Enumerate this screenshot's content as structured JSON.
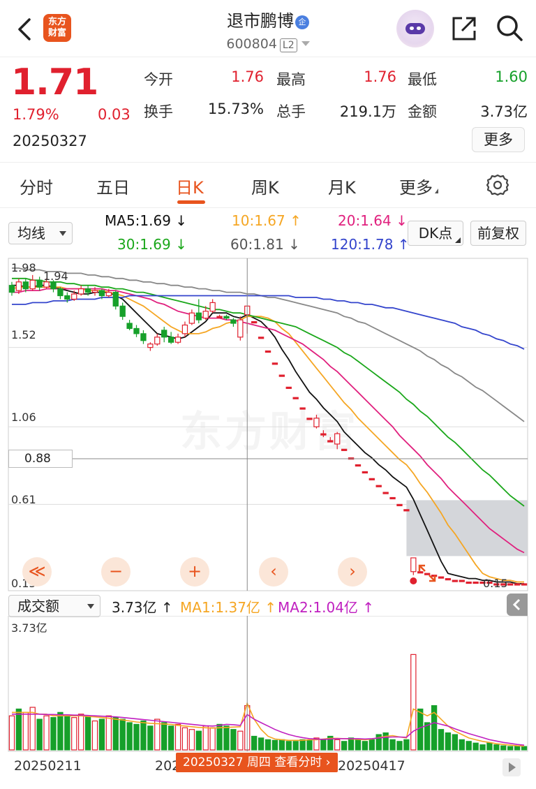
{
  "header": {
    "title": "退市鹏博",
    "badge": "企",
    "code": "600804",
    "level": "L2",
    "logo_text": "东方财富"
  },
  "quote": {
    "price": "1.71",
    "pct": "1.79%",
    "change": "0.03",
    "date": "20250327",
    "open_label": "今开",
    "open": "1.76",
    "high_label": "最高",
    "high": "1.76",
    "low_label": "最低",
    "low": "1.60",
    "turnover_label": "换手",
    "turnover": "15.73%",
    "volume_label": "总手",
    "volume": "219.1万",
    "amount_label": "金额",
    "amount": "3.73亿",
    "more": "更多"
  },
  "tabs": [
    "分时",
    "五日",
    "日K",
    "周K",
    "月K",
    "更多"
  ],
  "active_tab": "日K",
  "ma_bar": {
    "indicator": "均线",
    "ma5": "MA5:1.69",
    "ma5_arrow": "↓",
    "ma10": "10:1.67",
    "ma10_arrow": "↑",
    "ma20": "20:1.64",
    "ma20_arrow": "↓",
    "ma30": "30:1.69",
    "ma30_arrow": "↓",
    "ma60": "60:1.81",
    "ma60_arrow": "↓",
    "ma120": "120:1.78",
    "ma120_arrow": "↑",
    "dk_button": "DK点",
    "adjust_button": "前复权"
  },
  "colors": {
    "up": "#e0202e",
    "down": "#16a02a",
    "ma5": "#111111",
    "ma10": "#f5a623",
    "ma20": "#e0207e",
    "ma30": "#1aa71a",
    "ma60": "#888888",
    "ma120": "#3344cc",
    "accent": "#e8541e"
  },
  "axis": {
    "y_labels": [
      "1.98",
      "1.52",
      "1.06",
      "0.61",
      "0.15"
    ],
    "crosshair_price": "0.88",
    "high_annotation": "1.94",
    "low_annotation": "0.15"
  },
  "controls": [
    "≪",
    "−",
    "+",
    "‹",
    "›"
  ],
  "volume": {
    "indicator": "成交额",
    "value": "3.73亿",
    "value_arrow": "↑",
    "ma1": "MA1:1.37亿",
    "ma1_arrow": "↑",
    "ma2": "MA2:1.04亿",
    "ma2_arrow": "↑",
    "axis_max": "3.73亿"
  },
  "dates": {
    "d1": "20250211",
    "d2": "20250",
    "d3": "20250417",
    "tip": "20250327 周四 查看分时"
  },
  "watermark": "东方财富",
  "chart_data": {
    "type": "candlestick",
    "ylim": [
      0.15,
      1.98
    ],
    "candles": [
      {
        "o": 1.88,
        "c": 1.84,
        "h": 1.9,
        "l": 1.82
      },
      {
        "o": 1.85,
        "c": 1.9,
        "h": 1.92,
        "l": 1.83
      },
      {
        "o": 1.9,
        "c": 1.86,
        "h": 1.92,
        "l": 1.84
      },
      {
        "o": 1.86,
        "c": 1.91,
        "h": 1.94,
        "l": 1.85
      },
      {
        "o": 1.91,
        "c": 1.87,
        "h": 1.93,
        "l": 1.85
      },
      {
        "o": 1.87,
        "c": 1.9,
        "h": 1.92,
        "l": 1.86
      },
      {
        "o": 1.9,
        "c": 1.86,
        "h": 1.91,
        "l": 1.84
      },
      {
        "o": 1.86,
        "c": 1.82,
        "h": 1.87,
        "l": 1.8
      },
      {
        "o": 1.82,
        "c": 1.8,
        "h": 1.84,
        "l": 1.78
      },
      {
        "o": 1.8,
        "c": 1.83,
        "h": 1.85,
        "l": 1.79
      },
      {
        "o": 1.83,
        "c": 1.86,
        "h": 1.88,
        "l": 1.82
      },
      {
        "o": 1.86,
        "c": 1.84,
        "h": 1.88,
        "l": 1.82
      },
      {
        "o": 1.84,
        "c": 1.85,
        "h": 1.87,
        "l": 1.82
      },
      {
        "o": 1.85,
        "c": 1.82,
        "h": 1.86,
        "l": 1.8
      },
      {
        "o": 1.82,
        "c": 1.84,
        "h": 1.86,
        "l": 1.81
      },
      {
        "o": 1.84,
        "c": 1.76,
        "h": 1.85,
        "l": 1.74
      },
      {
        "o": 1.76,
        "c": 1.7,
        "h": 1.78,
        "l": 1.68
      },
      {
        "o": 1.66,
        "c": 1.63,
        "h": 1.68,
        "l": 1.62
      },
      {
        "o": 1.63,
        "c": 1.6,
        "h": 1.65,
        "l": 1.58
      },
      {
        "o": 1.6,
        "c": 1.56,
        "h": 1.62,
        "l": 1.54
      },
      {
        "o": 1.52,
        "c": 1.54,
        "h": 1.55,
        "l": 1.5
      },
      {
        "o": 1.54,
        "c": 1.58,
        "h": 1.6,
        "l": 1.53
      },
      {
        "o": 1.62,
        "c": 1.58,
        "h": 1.64,
        "l": 1.55
      },
      {
        "o": 1.58,
        "c": 1.55,
        "h": 1.61,
        "l": 1.54
      },
      {
        "o": 1.55,
        "c": 1.58,
        "h": 1.6,
        "l": 1.54
      },
      {
        "o": 1.6,
        "c": 1.65,
        "h": 1.67,
        "l": 1.58
      },
      {
        "o": 1.66,
        "c": 1.72,
        "h": 1.74,
        "l": 1.65
      },
      {
        "o": 1.72,
        "c": 1.68,
        "h": 1.8,
        "l": 1.66
      },
      {
        "o": 1.69,
        "c": 1.73,
        "h": 1.76,
        "l": 1.68
      },
      {
        "o": 1.73,
        "c": 1.78,
        "h": 1.8,
        "l": 1.72
      },
      {
        "o": 1.7,
        "c": 1.7,
        "h": 1.71,
        "l": 1.69
      },
      {
        "o": 1.7,
        "c": 1.69,
        "h": 1.71,
        "l": 1.68
      },
      {
        "o": 1.68,
        "c": 1.66,
        "h": 1.69,
        "l": 1.64
      },
      {
        "o": 1.58,
        "c": 1.68,
        "h": 1.7,
        "l": 1.56
      },
      {
        "o": 1.71,
        "c": 1.76,
        "h": 1.76,
        "l": 1.6
      },
      {
        "o": 1.67,
        "c": 1.67,
        "h": 1.67,
        "l": 1.67
      },
      {
        "o": 1.58,
        "c": 1.58,
        "h": 1.58,
        "l": 1.58
      },
      {
        "o": 1.5,
        "c": 1.5,
        "h": 1.5,
        "l": 1.5
      },
      {
        "o": 1.43,
        "c": 1.43,
        "h": 1.43,
        "l": 1.43
      },
      {
        "o": 1.36,
        "c": 1.36,
        "h": 1.36,
        "l": 1.36
      },
      {
        "o": 1.29,
        "c": 1.29,
        "h": 1.29,
        "l": 1.29
      },
      {
        "o": 1.23,
        "c": 1.23,
        "h": 1.23,
        "l": 1.23
      },
      {
        "o": 1.17,
        "c": 1.17,
        "h": 1.17,
        "l": 1.17
      },
      {
        "o": 1.11,
        "c": 1.11,
        "h": 1.11,
        "l": 1.11
      },
      {
        "o": 1.06,
        "c": 1.11,
        "h": 1.13,
        "l": 1.05
      },
      {
        "o": 1.02,
        "c": 1.02,
        "h": 1.04,
        "l": 1.0
      },
      {
        "o": 0.98,
        "c": 0.98,
        "h": 1.0,
        "l": 0.97
      },
      {
        "o": 0.96,
        "c": 1.02,
        "h": 1.03,
        "l": 0.93
      },
      {
        "o": 0.93,
        "c": 0.93,
        "h": 0.93,
        "l": 0.93
      },
      {
        "o": 0.88,
        "c": 0.88,
        "h": 0.88,
        "l": 0.88
      },
      {
        "o": 0.84,
        "c": 0.84,
        "h": 0.84,
        "l": 0.84
      },
      {
        "o": 0.8,
        "c": 0.8,
        "h": 0.8,
        "l": 0.8
      },
      {
        "o": 0.76,
        "c": 0.76,
        "h": 0.76,
        "l": 0.76
      },
      {
        "o": 0.72,
        "c": 0.72,
        "h": 0.72,
        "l": 0.72
      },
      {
        "o": 0.68,
        "c": 0.68,
        "h": 0.68,
        "l": 0.68
      },
      {
        "o": 0.65,
        "c": 0.65,
        "h": 0.65,
        "l": 0.65
      },
      {
        "o": 0.61,
        "c": 0.61,
        "h": 0.61,
        "l": 0.61
      },
      {
        "o": 0.58,
        "c": 0.58,
        "h": 0.58,
        "l": 0.58
      },
      {
        "o": 0.22,
        "c": 0.3,
        "h": 0.3,
        "l": 0.2
      },
      {
        "o": 0.22,
        "c": 0.22,
        "h": 0.22,
        "l": 0.22
      },
      {
        "o": 0.21,
        "c": 0.21,
        "h": 0.21,
        "l": 0.21
      },
      {
        "o": 0.2,
        "c": 0.2,
        "h": 0.2,
        "l": 0.2
      },
      {
        "o": 0.19,
        "c": 0.19,
        "h": 0.19,
        "l": 0.19
      },
      {
        "o": 0.18,
        "c": 0.18,
        "h": 0.18,
        "l": 0.18
      },
      {
        "o": 0.17,
        "c": 0.17,
        "h": 0.17,
        "l": 0.17
      },
      {
        "o": 0.17,
        "c": 0.17,
        "h": 0.17,
        "l": 0.17
      },
      {
        "o": 0.16,
        "c": 0.16,
        "h": 0.16,
        "l": 0.16
      },
      {
        "o": 0.16,
        "c": 0.16,
        "h": 0.16,
        "l": 0.16
      },
      {
        "o": 0.16,
        "c": 0.16,
        "h": 0.16,
        "l": 0.16
      },
      {
        "o": 0.16,
        "c": 0.16,
        "h": 0.16,
        "l": 0.16
      },
      {
        "o": 0.15,
        "c": 0.15,
        "h": 0.15,
        "l": 0.15
      },
      {
        "o": 0.15,
        "c": 0.15,
        "h": 0.15,
        "l": 0.15
      },
      {
        "o": 0.15,
        "c": 0.15,
        "h": 0.15,
        "l": 0.15
      },
      {
        "o": 0.15,
        "c": 0.15,
        "h": 0.15,
        "l": 0.15
      },
      {
        "o": 0.15,
        "c": 0.15,
        "h": 0.15,
        "l": 0.15
      }
    ],
    "ma_series": [
      {
        "key": "ma5",
        "values": [
          1.88,
          1.88,
          1.87,
          1.87,
          1.88,
          1.88,
          1.87,
          1.86,
          1.85,
          1.84,
          1.83,
          1.83,
          1.84,
          1.84,
          1.84,
          1.82,
          1.8,
          1.76,
          1.72,
          1.68,
          1.64,
          1.6,
          1.59,
          1.58,
          1.57,
          1.58,
          1.61,
          1.64,
          1.67,
          1.72,
          1.72,
          1.72,
          1.7,
          1.69,
          1.71,
          1.69,
          1.67,
          1.63,
          1.58,
          1.51,
          1.45,
          1.38,
          1.32,
          1.26,
          1.22,
          1.17,
          1.13,
          1.09,
          1.03,
          0.99,
          0.95,
          0.91,
          0.88,
          0.84,
          0.81,
          0.77,
          0.74,
          0.71,
          0.64,
          0.55,
          0.46,
          0.37,
          0.28,
          0.21,
          0.2,
          0.19,
          0.18,
          0.18,
          0.17,
          0.17,
          0.16,
          0.16,
          0.16,
          0.15,
          0.15
        ]
      },
      {
        "key": "ma10",
        "values": [
          1.86,
          1.87,
          1.87,
          1.87,
          1.87,
          1.87,
          1.87,
          1.87,
          1.86,
          1.86,
          1.86,
          1.85,
          1.85,
          1.85,
          1.84,
          1.83,
          1.82,
          1.8,
          1.78,
          1.76,
          1.73,
          1.7,
          1.67,
          1.64,
          1.62,
          1.6,
          1.6,
          1.6,
          1.61,
          1.63,
          1.64,
          1.66,
          1.67,
          1.68,
          1.7,
          1.7,
          1.7,
          1.69,
          1.67,
          1.63,
          1.6,
          1.55,
          1.5,
          1.45,
          1.4,
          1.35,
          1.3,
          1.25,
          1.2,
          1.16,
          1.11,
          1.07,
          1.03,
          0.99,
          0.95,
          0.91,
          0.87,
          0.84,
          0.79,
          0.73,
          0.68,
          0.62,
          0.56,
          0.49,
          0.44,
          0.38,
          0.32,
          0.26,
          0.21,
          0.19,
          0.18,
          0.17,
          0.17,
          0.16,
          0.16
        ]
      },
      {
        "key": "ma20",
        "values": [
          1.84,
          1.84,
          1.85,
          1.85,
          1.85,
          1.86,
          1.86,
          1.86,
          1.86,
          1.86,
          1.86,
          1.86,
          1.86,
          1.86,
          1.85,
          1.85,
          1.84,
          1.83,
          1.82,
          1.81,
          1.8,
          1.78,
          1.77,
          1.75,
          1.73,
          1.72,
          1.71,
          1.7,
          1.69,
          1.69,
          1.69,
          1.68,
          1.68,
          1.67,
          1.66,
          1.65,
          1.64,
          1.63,
          1.62,
          1.6,
          1.58,
          1.56,
          1.54,
          1.51,
          1.48,
          1.45,
          1.41,
          1.38,
          1.34,
          1.3,
          1.26,
          1.22,
          1.18,
          1.14,
          1.1,
          1.06,
          1.01,
          0.97,
          0.93,
          0.89,
          0.84,
          0.8,
          0.76,
          0.71,
          0.67,
          0.63,
          0.59,
          0.55,
          0.51,
          0.47,
          0.44,
          0.41,
          0.38,
          0.35,
          0.33
        ]
      },
      {
        "key": "ma30",
        "values": [
          1.92,
          1.92,
          1.92,
          1.91,
          1.91,
          1.9,
          1.9,
          1.9,
          1.89,
          1.89,
          1.88,
          1.88,
          1.88,
          1.87,
          1.87,
          1.86,
          1.86,
          1.85,
          1.84,
          1.84,
          1.83,
          1.82,
          1.81,
          1.8,
          1.79,
          1.78,
          1.77,
          1.76,
          1.75,
          1.74,
          1.74,
          1.73,
          1.72,
          1.72,
          1.71,
          1.7,
          1.69,
          1.68,
          1.67,
          1.66,
          1.65,
          1.64,
          1.62,
          1.6,
          1.58,
          1.56,
          1.54,
          1.52,
          1.49,
          1.47,
          1.44,
          1.41,
          1.38,
          1.35,
          1.32,
          1.29,
          1.26,
          1.22,
          1.19,
          1.15,
          1.12,
          1.08,
          1.04,
          1.0,
          0.97,
          0.93,
          0.89,
          0.85,
          0.81,
          0.78,
          0.74,
          0.7,
          0.66,
          0.63,
          0.6
        ]
      },
      {
        "key": "ma60",
        "values": [
          1.98,
          1.98,
          1.97,
          1.97,
          1.97,
          1.96,
          1.96,
          1.96,
          1.95,
          1.95,
          1.95,
          1.94,
          1.94,
          1.93,
          1.93,
          1.92,
          1.92,
          1.91,
          1.91,
          1.9,
          1.9,
          1.89,
          1.89,
          1.88,
          1.88,
          1.87,
          1.87,
          1.86,
          1.86,
          1.85,
          1.85,
          1.84,
          1.84,
          1.84,
          1.83,
          1.83,
          1.82,
          1.81,
          1.81,
          1.8,
          1.79,
          1.78,
          1.77,
          1.76,
          1.75,
          1.74,
          1.73,
          1.72,
          1.7,
          1.69,
          1.67,
          1.66,
          1.64,
          1.62,
          1.6,
          1.58,
          1.56,
          1.54,
          1.52,
          1.5,
          1.47,
          1.45,
          1.42,
          1.4,
          1.37,
          1.35,
          1.32,
          1.29,
          1.27,
          1.24,
          1.21,
          1.18,
          1.15,
          1.12,
          1.09
        ]
      },
      {
        "key": "ma120",
        "values": [
          1.77,
          1.77,
          1.77,
          1.78,
          1.78,
          1.78,
          1.79,
          1.79,
          1.79,
          1.8,
          1.8,
          1.8,
          1.8,
          1.81,
          1.81,
          1.81,
          1.81,
          1.82,
          1.82,
          1.82,
          1.82,
          1.82,
          1.82,
          1.82,
          1.82,
          1.82,
          1.82,
          1.82,
          1.82,
          1.82,
          1.82,
          1.82,
          1.82,
          1.82,
          1.82,
          1.82,
          1.82,
          1.82,
          1.82,
          1.82,
          1.82,
          1.81,
          1.81,
          1.81,
          1.81,
          1.8,
          1.8,
          1.79,
          1.79,
          1.78,
          1.78,
          1.77,
          1.77,
          1.76,
          1.75,
          1.75,
          1.74,
          1.73,
          1.72,
          1.71,
          1.7,
          1.69,
          1.68,
          1.67,
          1.66,
          1.64,
          1.63,
          1.62,
          1.6,
          1.59,
          1.57,
          1.56,
          1.54,
          1.53,
          1.51
        ]
      }
    ],
    "volume_ylim": [
      0,
      3.73
    ],
    "volume_bars": [
      1.0,
      1.2,
      1.1,
      1.25,
      0.9,
      1.0,
      0.95,
      1.1,
      1.0,
      0.95,
      1.05,
      1.0,
      0.85,
      0.9,
      1.0,
      0.95,
      0.9,
      0.8,
      0.75,
      0.85,
      0.7,
      0.9,
      0.8,
      0.7,
      0.75,
      0.65,
      0.6,
      0.55,
      0.7,
      0.65,
      0.75,
      0.7,
      0.6,
      0.55,
      1.3,
      0.4,
      0.35,
      0.3,
      0.28,
      0.3,
      0.25,
      0.25,
      0.3,
      0.28,
      0.35,
      0.3,
      0.4,
      0.3,
      0.25,
      0.35,
      0.3,
      0.25,
      0.3,
      0.45,
      0.5,
      0.3,
      0.25,
      0.3,
      2.8,
      1.2,
      0.8,
      1.3,
      0.6,
      0.5,
      0.45,
      0.3,
      0.25,
      0.2,
      0.15,
      0.2,
      0.15,
      0.12,
      0.1,
      0.1,
      0.1
    ],
    "volume_up": [
      1,
      0,
      1,
      1,
      0,
      1,
      0,
      0,
      0,
      1,
      1,
      0,
      1,
      0,
      1,
      0,
      0,
      0,
      0,
      0,
      0,
      1,
      0,
      0,
      1,
      1,
      1,
      0,
      1,
      1,
      0,
      0,
      0,
      1,
      1,
      0,
      0,
      0,
      0,
      0,
      0,
      0,
      0,
      0,
      1,
      0,
      0,
      1,
      0,
      0,
      0,
      0,
      0,
      0,
      0,
      0,
      0,
      0,
      1,
      0,
      0,
      0,
      0,
      0,
      0,
      0,
      0,
      0,
      0,
      0,
      0,
      0,
      0,
      0,
      0
    ],
    "volume_ma1": [
      1.1,
      1.1,
      1.1,
      1.1,
      1.05,
      1.05,
      1.0,
      1.0,
      1.0,
      1.0,
      1.0,
      0.98,
      0.97,
      0.95,
      0.93,
      0.9,
      0.88,
      0.85,
      0.82,
      0.8,
      0.78,
      0.77,
      0.76,
      0.75,
      0.72,
      0.7,
      0.68,
      0.66,
      0.65,
      0.64,
      0.65,
      0.66,
      0.67,
      0.68,
      1.37,
      0.9,
      0.6,
      0.4,
      0.32,
      0.3,
      0.28,
      0.28,
      0.28,
      0.3,
      0.3,
      0.32,
      0.34,
      0.34,
      0.33,
      0.32,
      0.31,
      0.3,
      0.32,
      0.36,
      0.4,
      0.42,
      0.38,
      0.35,
      1.2,
      1.1,
      1.0,
      1.1,
      0.9,
      0.7,
      0.55,
      0.45,
      0.35,
      0.3,
      0.25,
      0.22,
      0.18,
      0.16,
      0.14,
      0.12,
      0.11
    ],
    "volume_ma2": [
      1.05,
      1.05,
      1.05,
      1.05,
      1.05,
      1.04,
      1.04,
      1.03,
      1.03,
      1.02,
      1.02,
      1.01,
      1.0,
      0.99,
      0.98,
      0.97,
      0.95,
      0.93,
      0.91,
      0.89,
      0.87,
      0.85,
      0.83,
      0.81,
      0.79,
      0.77,
      0.75,
      0.73,
      0.71,
      0.7,
      0.72,
      0.75,
      0.74,
      0.72,
      1.04,
      0.9,
      0.8,
      0.7,
      0.6,
      0.52,
      0.45,
      0.4,
      0.36,
      0.33,
      0.32,
      0.31,
      0.32,
      0.33,
      0.33,
      0.33,
      0.33,
      0.32,
      0.33,
      0.35,
      0.37,
      0.38,
      0.38,
      0.37,
      0.55,
      0.65,
      0.72,
      0.8,
      0.75,
      0.7,
      0.62,
      0.55,
      0.48,
      0.42,
      0.36,
      0.3,
      0.26,
      0.22,
      0.19,
      0.16,
      0.14
    ]
  }
}
